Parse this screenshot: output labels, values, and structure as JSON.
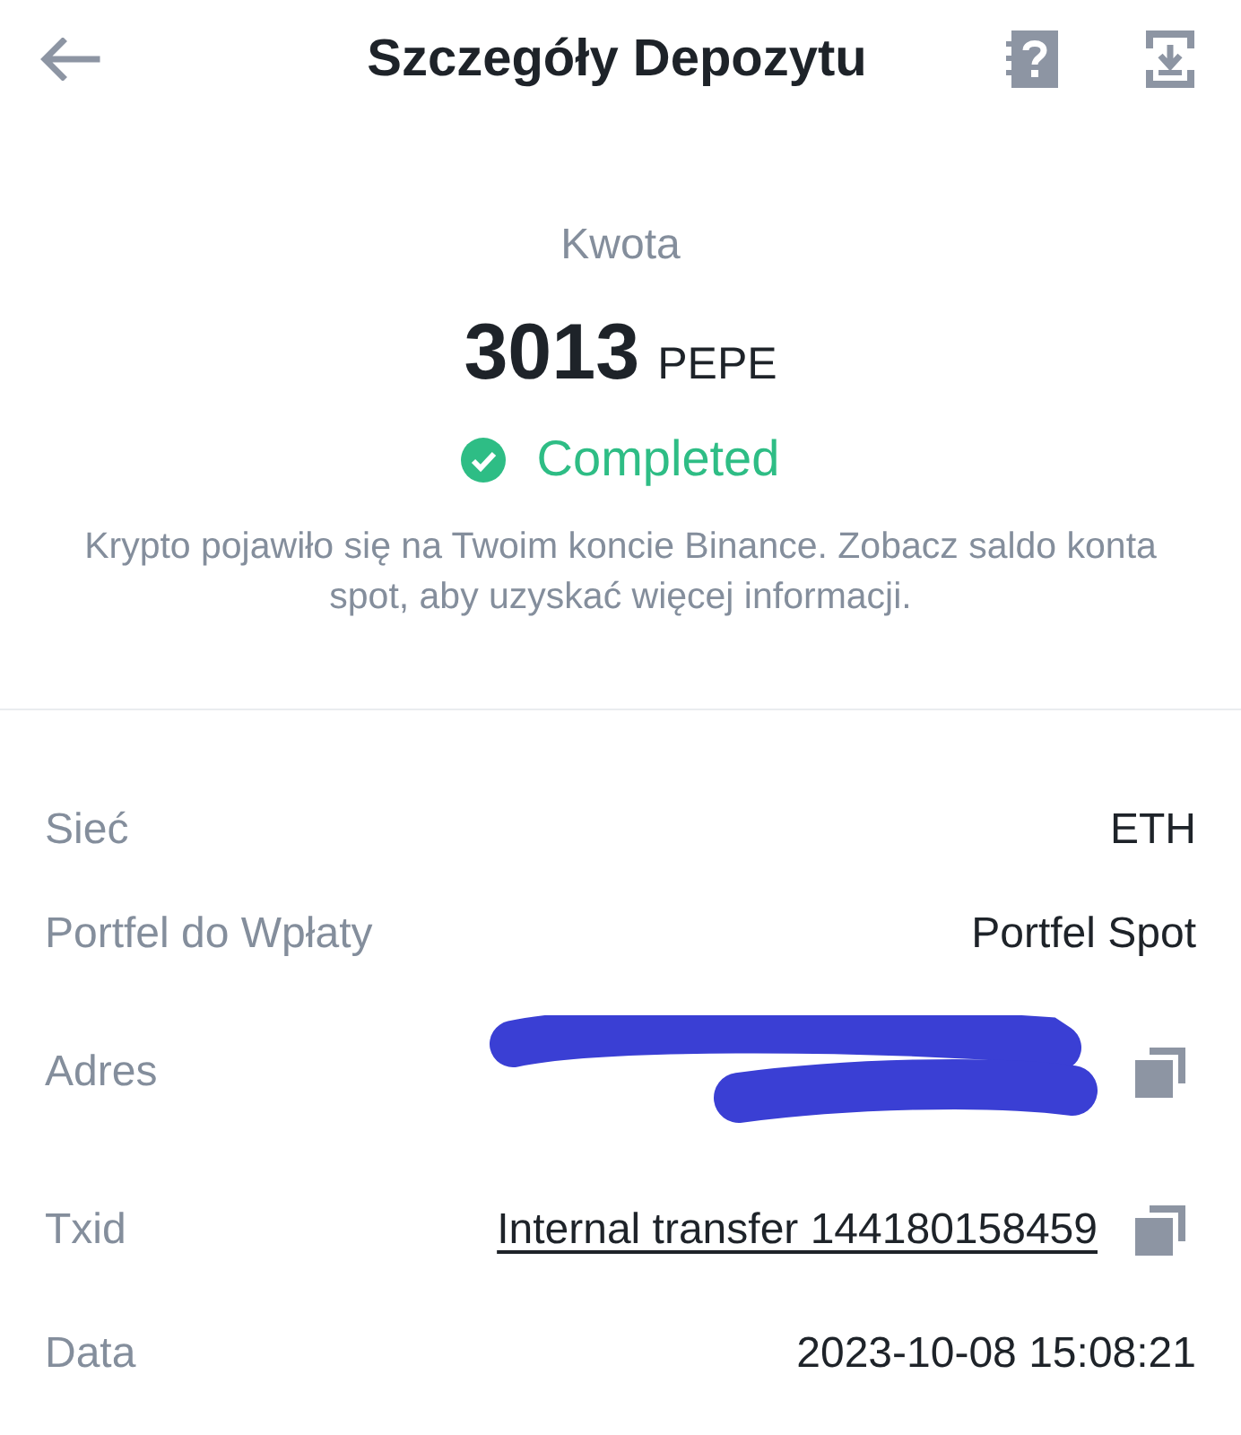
{
  "header": {
    "title": "Szczegóły Depozytu"
  },
  "summary": {
    "label": "Kwota",
    "amount": "3013",
    "unit": "PEPE",
    "status": {
      "kind": "completed",
      "text": "Completed"
    },
    "note": "Krypto pojawiło się na Twoim koncie Binance. Zobacz saldo konta spot, aby uzyskać więcej informacji."
  },
  "details": [
    {
      "kind": "text",
      "label": "Sieć",
      "value": "ETH",
      "copyable": false
    },
    {
      "kind": "text",
      "label": "Portfel do Wpłaty",
      "value": "Portfel Spot",
      "copyable": false
    },
    {
      "kind": "redacted",
      "label": "Adres",
      "copyable": true
    },
    {
      "kind": "link",
      "label": "Txid",
      "value": "Internal transfer 144180158459",
      "copyable": true
    },
    {
      "kind": "text",
      "label": "Data",
      "value": "2023-10-08 15:08:21",
      "copyable": false
    }
  ]
}
